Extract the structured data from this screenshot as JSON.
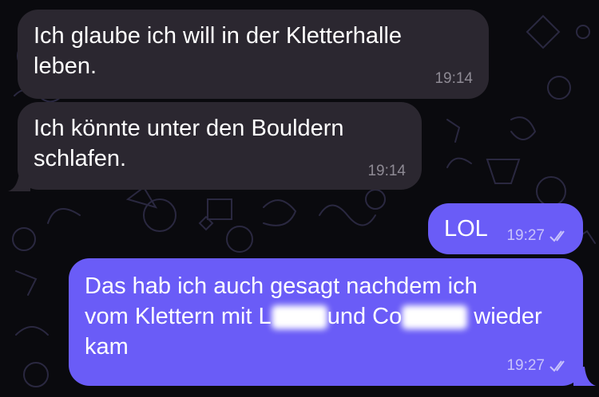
{
  "messages": [
    {
      "text_line1": "Ich glaube ich will in der Kletterhalle",
      "text_line2": "leben.",
      "time": "19:14",
      "direction": "incoming"
    },
    {
      "text_line1": "Ich könnte unter den Bouldern",
      "text_line2": "schlafen.",
      "time": "19:14",
      "direction": "incoming"
    },
    {
      "text": "LOL",
      "time": "19:27",
      "direction": "outgoing",
      "status_icon": "double-check-icon"
    },
    {
      "text_line1": "Das hab ich auch gesagt nachdem ich",
      "text_line2a": "vom Klettern mit L",
      "text_line2b": "und Co",
      "text_line2c": "wieder",
      "text_line3": "kam",
      "time": "19:27",
      "direction": "outgoing",
      "status_icon": "double-check-icon"
    }
  ],
  "colors": {
    "background": "#0a0a0e",
    "incoming_bubble": "#2b2730",
    "outgoing_bubble": "#6a5cf7",
    "doodle_stroke": "#2a2840"
  }
}
